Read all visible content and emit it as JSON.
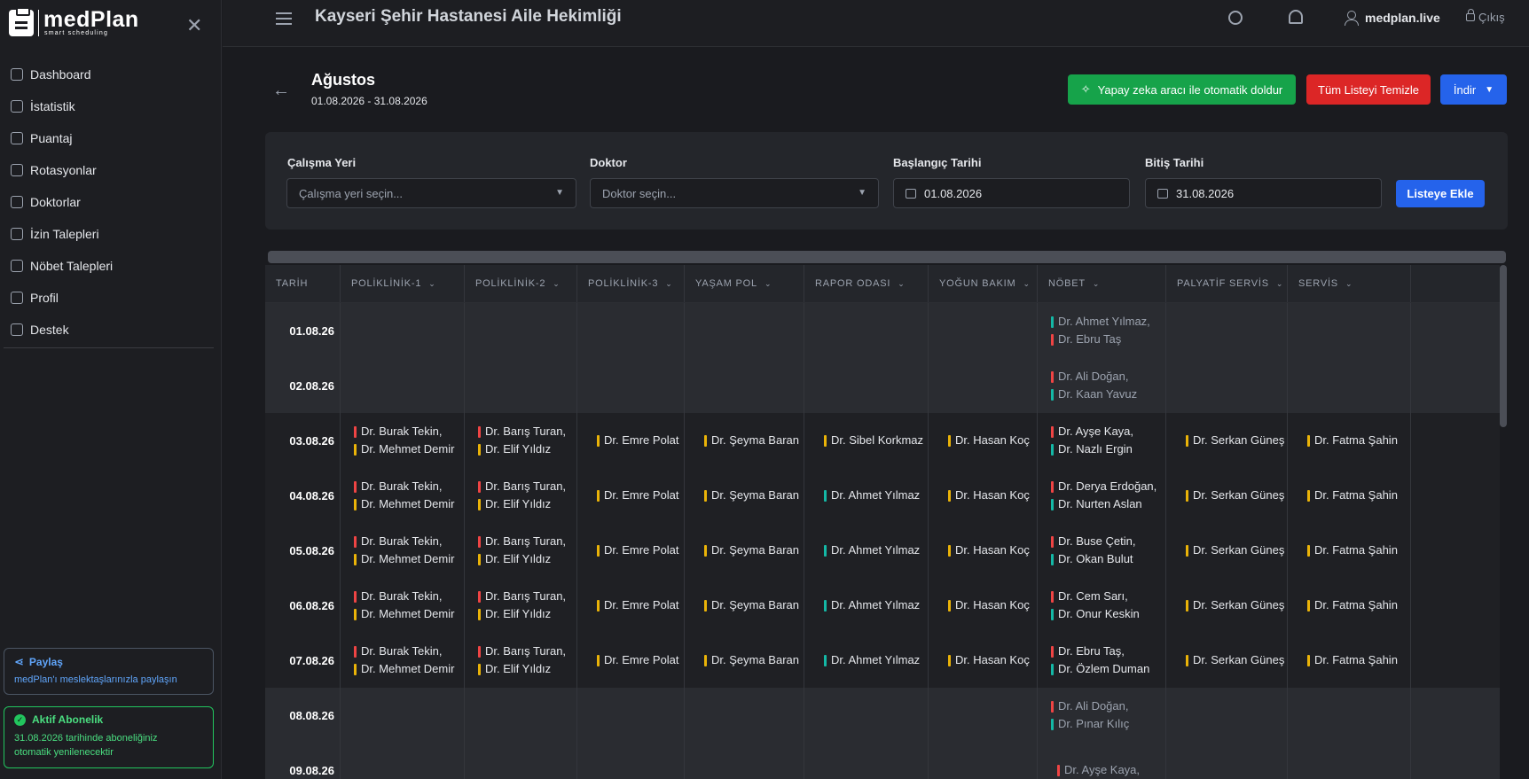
{
  "app": {
    "name": "medPlan",
    "tagline": "smart scheduling"
  },
  "sidebar": {
    "items": [
      {
        "label": "Dashboard",
        "icon": "home-icon"
      },
      {
        "label": "İstatistik",
        "icon": "chart-icon"
      },
      {
        "label": "Puantaj",
        "icon": "table-icon"
      },
      {
        "label": "Rotasyonlar",
        "icon": "calendar-icon"
      },
      {
        "label": "Doktorlar",
        "icon": "users-icon"
      },
      {
        "label": "İzin Talepleri",
        "icon": "calendar-check-icon"
      },
      {
        "label": "Nöbet Talepleri",
        "icon": "inbox-icon"
      },
      {
        "label": "Profil",
        "icon": "user-icon"
      },
      {
        "label": "Destek",
        "icon": "chat-icon"
      }
    ],
    "share": {
      "title": "Paylaş",
      "text": "medPlan'ı meslektaşlarınızla paylaşın"
    },
    "subscription": {
      "title": "Aktif Abonelik",
      "text": "31.08.2026 tarihinde aboneliğiniz otomatik yenilenecektir"
    }
  },
  "header": {
    "title": "Kayseri Şehir Hastanesi Aile Hekimliği",
    "user": "medplan.live",
    "logout": "Çıkış"
  },
  "page": {
    "title": "Ağustos",
    "range": "01.08.2026 - 31.08.2026",
    "ai_button": "Yapay zeka aracı ile otomatik doldur",
    "clear_button": "Tüm Listeyi Temizle",
    "download_button": "İndir"
  },
  "filter": {
    "workplace_label": "Çalışma Yeri",
    "workplace_placeholder": "Çalışma yeri seçin...",
    "doctor_label": "Doktor",
    "doctor_placeholder": "Doktor seçin...",
    "start_label": "Başlangıç Tarihi",
    "start_value": "01.08.2026",
    "end_label": "Bitiş Tarihi",
    "end_value": "31.08.2026",
    "add_button": "Listeye Ekle"
  },
  "colors": {
    "red": "#ef4444",
    "yellow": "#eab308",
    "teal": "#14b8a6"
  },
  "table": {
    "columns": [
      "TARİH",
      "POLİKLİNİK-1",
      "POLİKLİNİK-2",
      "POLİKLİNİK-3",
      "YAŞAM POL",
      "RAPOR ODASI",
      "YOĞUN BAKIM",
      "NÖBET",
      "PALYATİF SERVİS",
      "SERVİS"
    ],
    "rows": [
      {
        "date": "01.08.26",
        "weekend": true,
        "cells": [
          [],
          [],
          [],
          [],
          [],
          [],
          [
            [
              "Dr. Ahmet Yılmaz,",
              "teal"
            ],
            [
              "Dr. Ebru Taş",
              "red"
            ]
          ],
          [],
          []
        ]
      },
      {
        "date": "02.08.26",
        "weekend": true,
        "cells": [
          [],
          [],
          [],
          [],
          [],
          [],
          [
            [
              "Dr. Ali Doğan,",
              "red"
            ],
            [
              "Dr. Kaan Yavuz",
              "teal"
            ]
          ],
          [],
          []
        ]
      },
      {
        "date": "03.08.26",
        "weekend": false,
        "cells": [
          [
            [
              "Dr. Burak Tekin,",
              "red"
            ],
            [
              "Dr. Mehmet Demir",
              "yellow"
            ]
          ],
          [
            [
              "Dr. Barış Turan,",
              "red"
            ],
            [
              "Dr. Elif Yıldız",
              "yellow"
            ]
          ],
          [
            [
              "Dr. Emre Polat",
              "yellow"
            ]
          ],
          [
            [
              "Dr. Şeyma Baran",
              "yellow"
            ]
          ],
          [
            [
              "Dr. Sibel Korkmaz",
              "yellow"
            ]
          ],
          [
            [
              "Dr. Hasan Koç",
              "yellow"
            ]
          ],
          [
            [
              "Dr. Ayşe Kaya,",
              "red"
            ],
            [
              "Dr. Nazlı Ergin",
              "teal"
            ]
          ],
          [
            [
              "Dr. Serkan Güneş",
              "yellow"
            ]
          ],
          [
            [
              "Dr. Fatma Şahin",
              "yellow"
            ]
          ]
        ]
      },
      {
        "date": "04.08.26",
        "weekend": false,
        "cells": [
          [
            [
              "Dr. Burak Tekin,",
              "red"
            ],
            [
              "Dr. Mehmet Demir",
              "yellow"
            ]
          ],
          [
            [
              "Dr. Barış Turan,",
              "red"
            ],
            [
              "Dr. Elif Yıldız",
              "yellow"
            ]
          ],
          [
            [
              "Dr. Emre Polat",
              "yellow"
            ]
          ],
          [
            [
              "Dr. Şeyma Baran",
              "yellow"
            ]
          ],
          [
            [
              "Dr. Ahmet Yılmaz",
              "teal"
            ]
          ],
          [
            [
              "Dr. Hasan Koç",
              "yellow"
            ]
          ],
          [
            [
              "Dr. Derya Erdoğan,",
              "red"
            ],
            [
              "Dr. Nurten Aslan",
              "teal"
            ]
          ],
          [
            [
              "Dr. Serkan Güneş",
              "yellow"
            ]
          ],
          [
            [
              "Dr. Fatma Şahin",
              "yellow"
            ]
          ]
        ]
      },
      {
        "date": "05.08.26",
        "weekend": false,
        "cells": [
          [
            [
              "Dr. Burak Tekin,",
              "red"
            ],
            [
              "Dr. Mehmet Demir",
              "yellow"
            ]
          ],
          [
            [
              "Dr. Barış Turan,",
              "red"
            ],
            [
              "Dr. Elif Yıldız",
              "yellow"
            ]
          ],
          [
            [
              "Dr. Emre Polat",
              "yellow"
            ]
          ],
          [
            [
              "Dr. Şeyma Baran",
              "yellow"
            ]
          ],
          [
            [
              "Dr. Ahmet Yılmaz",
              "teal"
            ]
          ],
          [
            [
              "Dr. Hasan Koç",
              "yellow"
            ]
          ],
          [
            [
              "Dr. Buse Çetin,",
              "red"
            ],
            [
              "Dr. Okan Bulut",
              "teal"
            ]
          ],
          [
            [
              "Dr. Serkan Güneş",
              "yellow"
            ]
          ],
          [
            [
              "Dr. Fatma Şahin",
              "yellow"
            ]
          ]
        ]
      },
      {
        "date": "06.08.26",
        "weekend": false,
        "cells": [
          [
            [
              "Dr. Burak Tekin,",
              "red"
            ],
            [
              "Dr. Mehmet Demir",
              "yellow"
            ]
          ],
          [
            [
              "Dr. Barış Turan,",
              "red"
            ],
            [
              "Dr. Elif Yıldız",
              "yellow"
            ]
          ],
          [
            [
              "Dr. Emre Polat",
              "yellow"
            ]
          ],
          [
            [
              "Dr. Şeyma Baran",
              "yellow"
            ]
          ],
          [
            [
              "Dr. Ahmet Yılmaz",
              "teal"
            ]
          ],
          [
            [
              "Dr. Hasan Koç",
              "yellow"
            ]
          ],
          [
            [
              "Dr. Cem Sarı,",
              "red"
            ],
            [
              "Dr. Onur Keskin",
              "teal"
            ]
          ],
          [
            [
              "Dr. Serkan Güneş",
              "yellow"
            ]
          ],
          [
            [
              "Dr. Fatma Şahin",
              "yellow"
            ]
          ]
        ]
      },
      {
        "date": "07.08.26",
        "weekend": false,
        "cells": [
          [
            [
              "Dr. Burak Tekin,",
              "red"
            ],
            [
              "Dr. Mehmet Demir",
              "yellow"
            ]
          ],
          [
            [
              "Dr. Barış Turan,",
              "red"
            ],
            [
              "Dr. Elif Yıldız",
              "yellow"
            ]
          ],
          [
            [
              "Dr. Emre Polat",
              "yellow"
            ]
          ],
          [
            [
              "Dr. Şeyma Baran",
              "yellow"
            ]
          ],
          [
            [
              "Dr. Ahmet Yılmaz",
              "teal"
            ]
          ],
          [
            [
              "Dr. Hasan Koç",
              "yellow"
            ]
          ],
          [
            [
              "Dr. Ebru Taş,",
              "red"
            ],
            [
              "Dr. Özlem Duman",
              "teal"
            ]
          ],
          [
            [
              "Dr. Serkan Güneş",
              "yellow"
            ]
          ],
          [
            [
              "Dr. Fatma Şahin",
              "yellow"
            ]
          ]
        ]
      },
      {
        "date": "08.08.26",
        "weekend": true,
        "cells": [
          [],
          [],
          [],
          [],
          [],
          [],
          [
            [
              "Dr. Ali Doğan,",
              "red"
            ],
            [
              "Dr. Pınar Kılıç",
              "teal"
            ]
          ],
          [],
          []
        ]
      },
      {
        "date": "09.08.26",
        "weekend": true,
        "cells": [
          [],
          [],
          [],
          [],
          [],
          [],
          [
            [
              "Dr. Ayşe Kaya,",
              "red"
            ]
          ],
          [],
          []
        ]
      }
    ]
  }
}
